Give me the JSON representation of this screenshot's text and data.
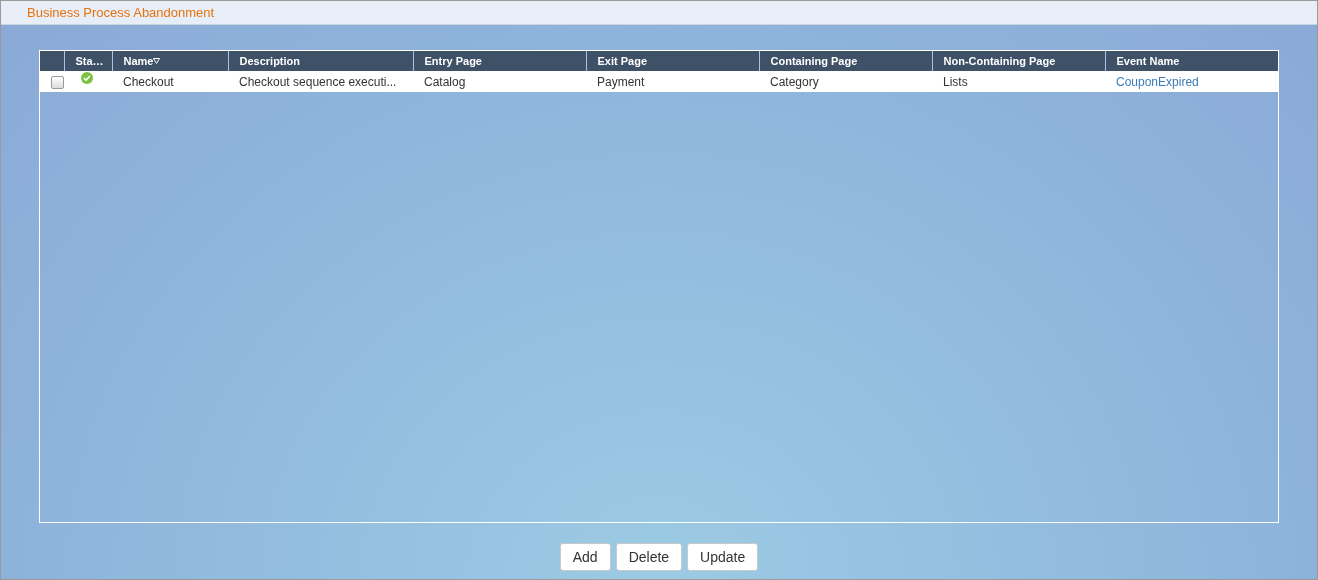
{
  "panel": {
    "title": "Business Process Abandonment"
  },
  "table": {
    "columns": [
      {
        "label": "Sta…",
        "sorted": false
      },
      {
        "label": "Name",
        "sorted": true
      },
      {
        "label": "Description",
        "sorted": false
      },
      {
        "label": "Entry Page",
        "sorted": false
      },
      {
        "label": "Exit Page",
        "sorted": false
      },
      {
        "label": "Containing Page",
        "sorted": false
      },
      {
        "label": "Non-Containing Page",
        "sorted": false
      },
      {
        "label": "Event Name",
        "sorted": false
      }
    ],
    "rows": [
      {
        "checked": false,
        "cells": [
          {
            "kind": "status",
            "ok": true
          },
          {
            "kind": "text",
            "text": "Checkout"
          },
          {
            "kind": "text",
            "text": "Checkout sequence executi..."
          },
          {
            "kind": "text",
            "text": "Catalog"
          },
          {
            "kind": "text",
            "text": "Payment"
          },
          {
            "kind": "text",
            "text": "Category"
          },
          {
            "kind": "text",
            "text": "Lists"
          },
          {
            "kind": "link",
            "text": "CouponExpired"
          }
        ]
      }
    ]
  },
  "buttons": [
    "Add",
    "Delete",
    "Update"
  ]
}
